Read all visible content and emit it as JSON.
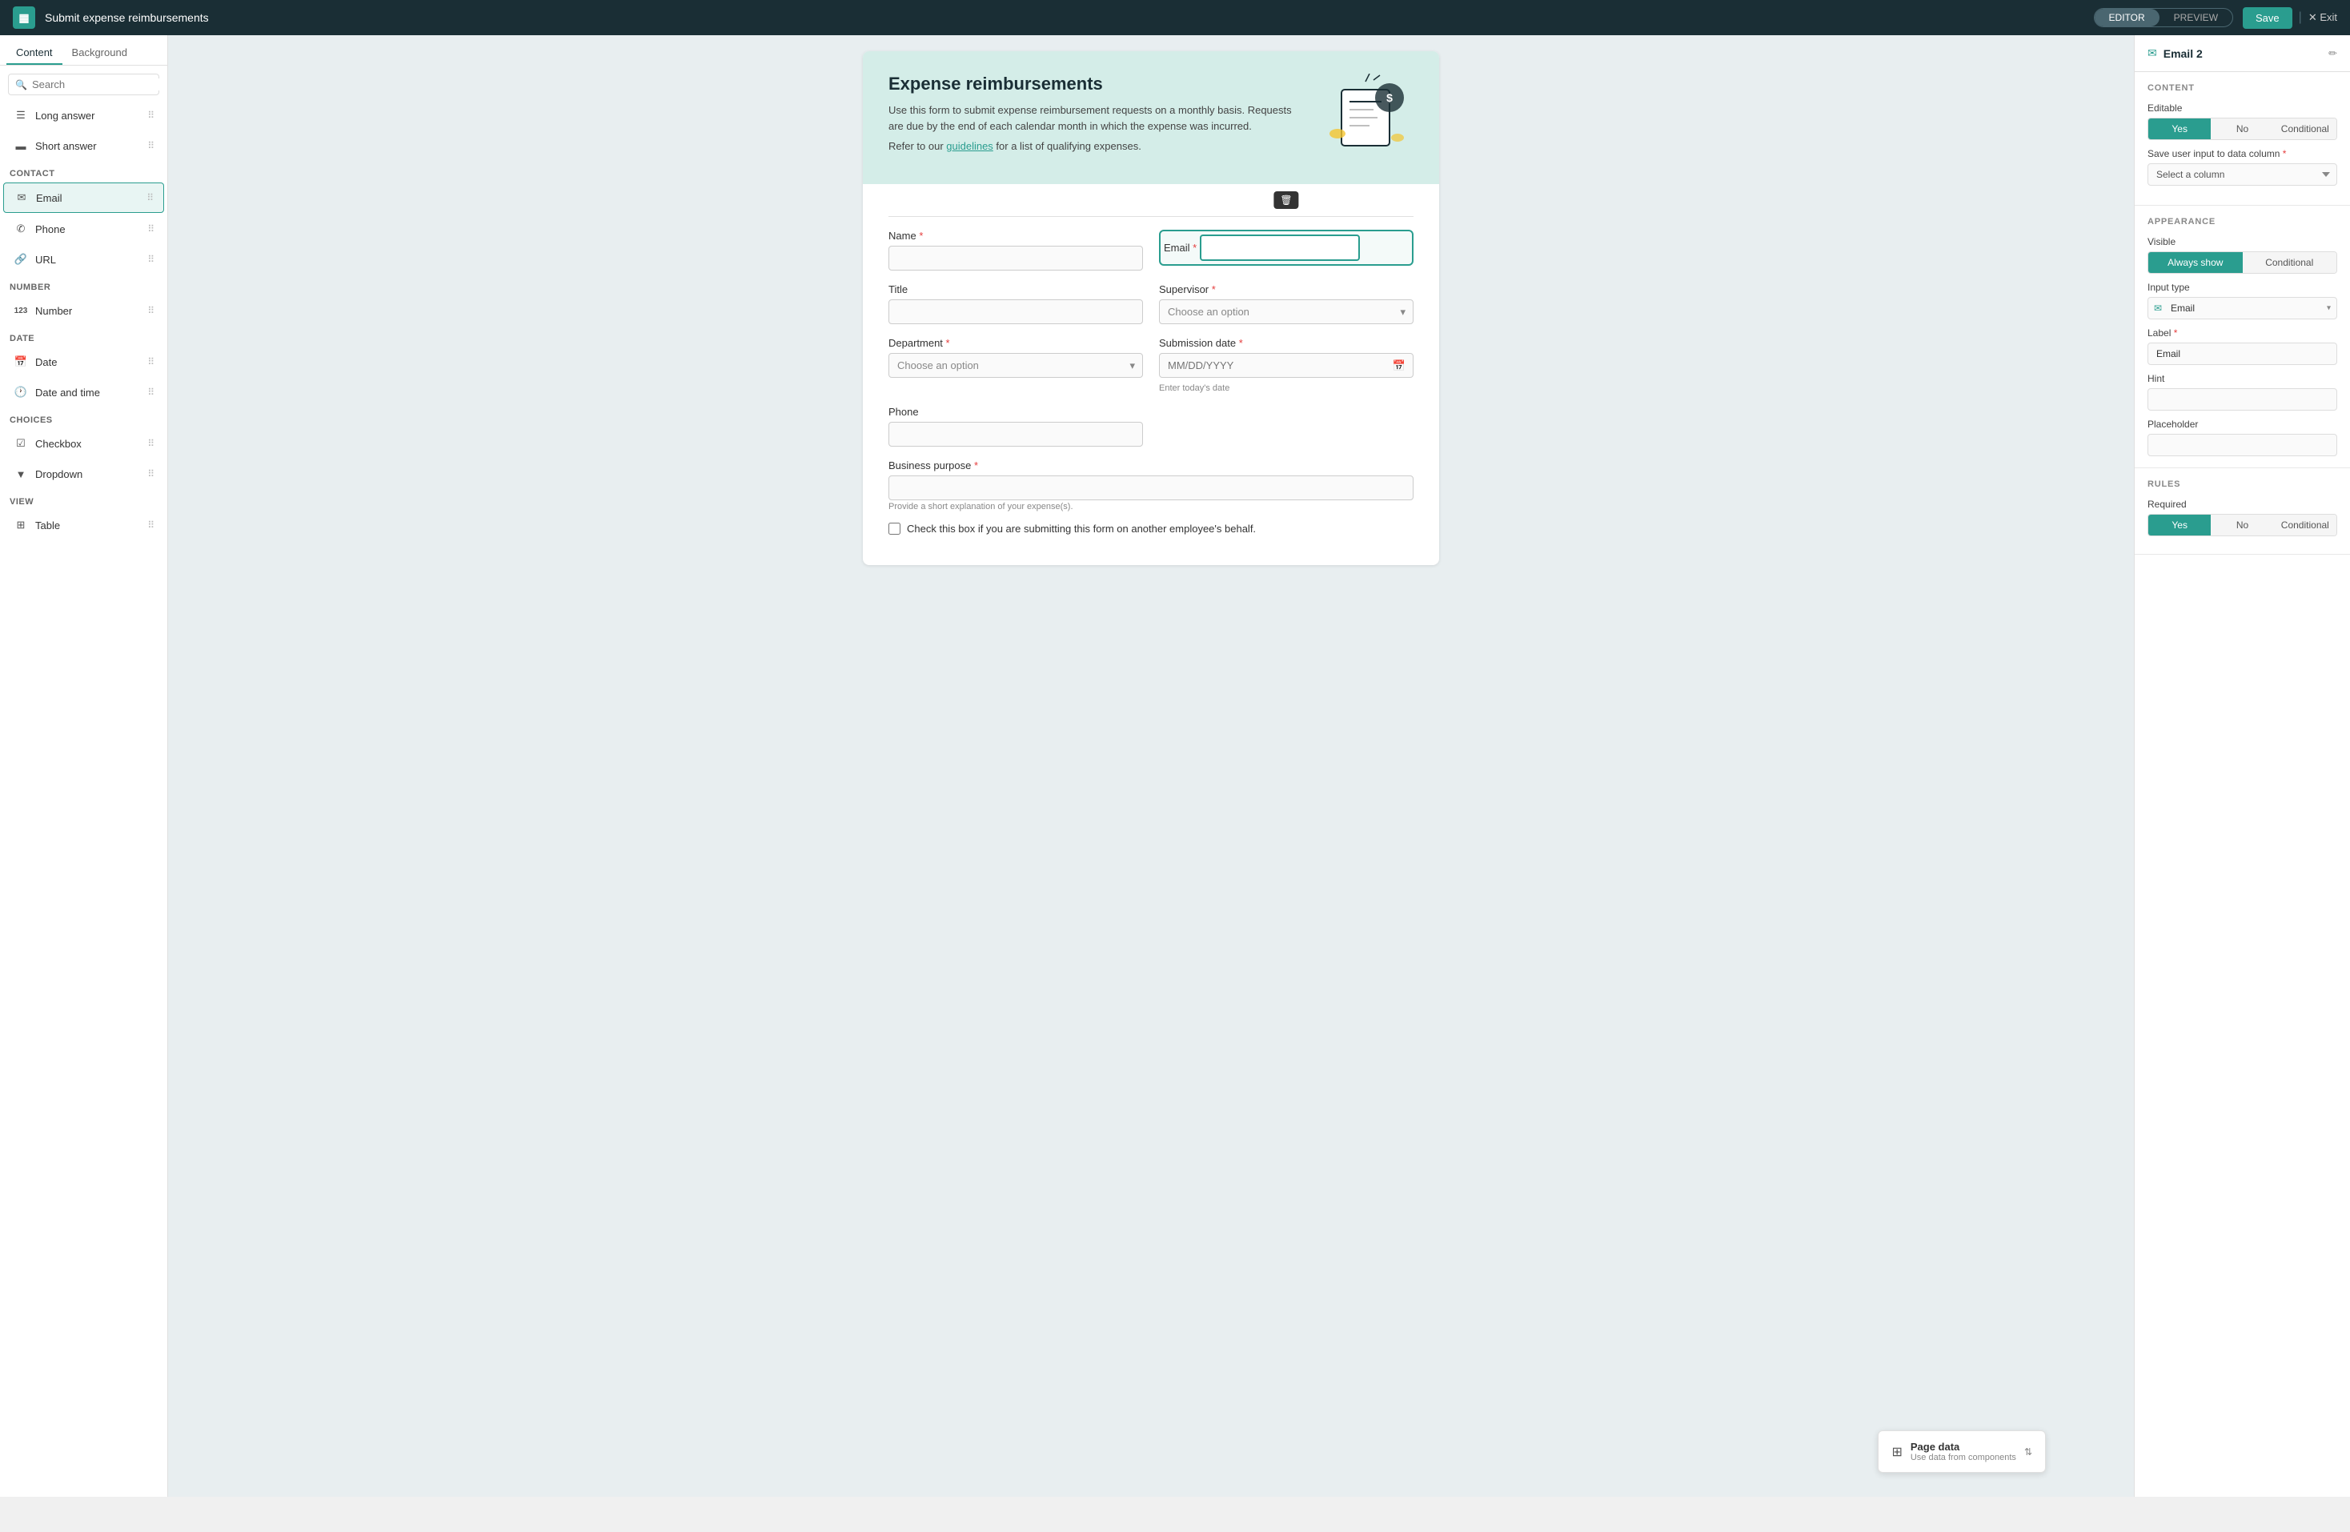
{
  "app": {
    "title": "Submit expense reimbursements",
    "logo_char": "▦",
    "save_label": "Save",
    "exit_label": "✕ Exit"
  },
  "topbar": {
    "editor_label": "EDITOR",
    "preview_label": "PREVIEW"
  },
  "sidebar": {
    "tab_content": "Content",
    "tab_background": "Background",
    "search_placeholder": "Search",
    "items": [
      {
        "id": "long-answer",
        "icon": "☰",
        "label": "Long answer",
        "section": null
      },
      {
        "id": "short-answer",
        "icon": "▬",
        "label": "Short answer",
        "section": null
      },
      {
        "id": "contact",
        "section_label": "CONTACT"
      },
      {
        "id": "email",
        "icon": "✉",
        "label": "Email",
        "section": "contact"
      },
      {
        "id": "phone",
        "icon": "✆",
        "label": "Phone",
        "section": "contact"
      },
      {
        "id": "url",
        "icon": "🔗",
        "label": "URL",
        "section": "contact"
      },
      {
        "id": "number",
        "section_label": "NUMBER"
      },
      {
        "id": "number-item",
        "icon": "123",
        "label": "Number",
        "section": "number"
      },
      {
        "id": "date",
        "section_label": "DATE"
      },
      {
        "id": "date-item",
        "icon": "📅",
        "label": "Date",
        "section": "date"
      },
      {
        "id": "date-time",
        "icon": "🕐",
        "label": "Date and time",
        "section": "date"
      },
      {
        "id": "choices",
        "section_label": "CHOICES"
      },
      {
        "id": "checkbox",
        "icon": "☑",
        "label": "Checkbox",
        "section": "choices"
      },
      {
        "id": "dropdown",
        "icon": "▼",
        "label": "Dropdown",
        "section": "choices"
      },
      {
        "id": "view",
        "section_label": "VIEW"
      },
      {
        "id": "table",
        "icon": "⊞",
        "label": "Table",
        "section": "view"
      }
    ]
  },
  "form": {
    "title": "Expense reimbursements",
    "description": "Use this form to submit expense reimbursement requests on a monthly basis. Requests are due by the end of each calendar month in which the expense was incurred.",
    "guidelines_link": "guidelines",
    "guidelines_text": "Refer to our guidelines for a list of qualifying expenses.",
    "name_label": "Name",
    "email_label": "Email",
    "title_label": "Title",
    "supervisor_label": "Supervisor",
    "supervisor_placeholder": "Choose an option",
    "department_label": "Department",
    "department_placeholder": "Choose an option",
    "submission_date_label": "Submission date",
    "submission_date_placeholder": "MM/DD/YYYY",
    "submission_date_hint": "Enter today's date",
    "phone_label": "Phone",
    "business_purpose_label": "Business purpose",
    "business_purpose_hint": "Provide a short explanation of your expense(s).",
    "checkbox_label": "Check this box if you are submitting this form on another employee's behalf."
  },
  "right_panel": {
    "email_panel_title": "Email 2",
    "content_section": "CONTENT",
    "editable_label": "Editable",
    "yes_label": "Yes",
    "no_label": "No",
    "conditional_label": "Conditional",
    "save_user_input_label": "Save user input to data column",
    "select_column_placeholder": "Select a column",
    "appearance_section": "APPEARANCE",
    "visible_label": "Visible",
    "always_show_label": "Always show",
    "input_type_label": "Input type",
    "input_type_value": "Email",
    "label_field_label": "Label",
    "label_field_value": "Email",
    "hint_label": "Hint",
    "hint_value": "",
    "placeholder_label": "Placeholder",
    "placeholder_value": "",
    "rules_section": "RULES",
    "required_label": "Required",
    "req_yes": "Yes",
    "req_no": "No",
    "req_conditional": "Conditional"
  },
  "page_data_tooltip": {
    "title": "Page data",
    "subtitle": "Use data from components"
  }
}
